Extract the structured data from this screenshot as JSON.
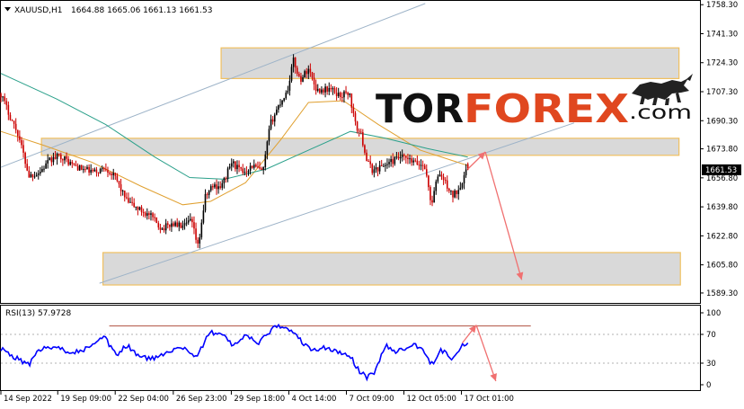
{
  "header": {
    "symbol": "XAUUSD,H1",
    "ohlc": "1664.88 1665.06 1661.13 1661.53"
  },
  "logo": {
    "part1": "TOR",
    "part2": "FOREX",
    "suffix": ".com"
  },
  "colors": {
    "bull_candle": "#000000",
    "bear_candle": "#cc0000",
    "ma_fast": "#e0a030",
    "ma_slow": "#2aa08a",
    "channel": "#9db3c8",
    "zone_fill": "#d9d9d9",
    "zone_border": "#f0c060",
    "forecast_arrow": "#f07070",
    "rsi_line": "#0000ff",
    "rsi_resistance": "#b05040"
  },
  "chart_data": [
    {
      "type": "candlestick",
      "title": "XAUUSD,H1",
      "symbol": "XAUUSD",
      "timeframe": "H1",
      "last_bar": {
        "open": 1664.88,
        "high": 1665.06,
        "low": 1661.13,
        "close": 1661.53
      },
      "current_price_label": "1661.53",
      "ylim": [
        1584.0,
        1760.0
      ],
      "y_ticks": [
        "1758.30",
        "1741.30",
        "1724.30",
        "1707.30",
        "1690.30",
        "1673.80",
        "1656.80",
        "1639.80",
        "1622.80",
        "1605.80",
        "1589.30"
      ],
      "y_tick_values": [
        1758.3,
        1741.3,
        1724.3,
        1707.3,
        1690.3,
        1673.8,
        1656.8,
        1639.8,
        1622.8,
        1605.8,
        1589.3
      ],
      "x_ticks": [
        "14 Sep 2022",
        "19 Sep 09:00",
        "22 Sep 04:00",
        "26 Sep 23:00",
        "29 Sep 18:00",
        "4 Oct 14:00",
        "7 Oct 09:00",
        "12 Oct 05:00",
        "17 Oct 01:00"
      ],
      "x_tick_pos": [
        0,
        0.0813,
        0.1635,
        0.2466,
        0.3296,
        0.4119,
        0.4942,
        0.5765,
        0.6588
      ],
      "price_path": [
        [
          0.0,
          1706
        ],
        [
          0.012,
          1694
        ],
        [
          0.025,
          1682
        ],
        [
          0.04,
          1658
        ],
        [
          0.055,
          1660
        ],
        [
          0.07,
          1667
        ],
        [
          0.085,
          1670
        ],
        [
          0.1,
          1665
        ],
        [
          0.115,
          1662
        ],
        [
          0.135,
          1660
        ],
        [
          0.15,
          1663
        ],
        [
          0.165,
          1656
        ],
        [
          0.18,
          1643
        ],
        [
          0.195,
          1639
        ],
        [
          0.215,
          1634
        ],
        [
          0.23,
          1627
        ],
        [
          0.245,
          1630
        ],
        [
          0.262,
          1628
        ],
        [
          0.272,
          1632
        ],
        [
          0.282,
          1616
        ],
        [
          0.292,
          1645
        ],
        [
          0.302,
          1652
        ],
        [
          0.316,
          1652
        ],
        [
          0.33,
          1666
        ],
        [
          0.345,
          1660
        ],
        [
          0.36,
          1664
        ],
        [
          0.375,
          1660
        ],
        [
          0.385,
          1688
        ],
        [
          0.397,
          1699
        ],
        [
          0.41,
          1708
        ],
        [
          0.418,
          1726
        ],
        [
          0.428,
          1714
        ],
        [
          0.44,
          1721
        ],
        [
          0.452,
          1708
        ],
        [
          0.47,
          1709
        ],
        [
          0.485,
          1705
        ],
        [
          0.498,
          1707
        ],
        [
          0.507,
          1688
        ],
        [
          0.516,
          1681
        ],
        [
          0.524,
          1666
        ],
        [
          0.532,
          1661
        ],
        [
          0.552,
          1665
        ],
        [
          0.572,
          1669
        ],
        [
          0.595,
          1665
        ],
        [
          0.606,
          1664
        ],
        [
          0.616,
          1641
        ],
        [
          0.626,
          1660
        ],
        [
          0.633,
          1656
        ],
        [
          0.646,
          1646
        ],
        [
          0.654,
          1650
        ],
        [
          0.664,
          1659
        ],
        [
          0.668,
          1661.53
        ]
      ],
      "moving_averages": [
        {
          "name": "MA fast",
          "color": "#e0a030",
          "points": [
            [
              0.0,
              1684
            ],
            [
              0.06,
              1676
            ],
            [
              0.13,
              1666
            ],
            [
              0.2,
              1652
            ],
            [
              0.26,
              1641
            ],
            [
              0.3,
              1643
            ],
            [
              0.35,
              1654
            ],
            [
              0.4,
              1679
            ],
            [
              0.44,
              1701
            ],
            [
              0.49,
              1702
            ],
            [
              0.54,
              1688
            ],
            [
              0.6,
              1673
            ],
            [
              0.668,
              1664
            ]
          ]
        },
        {
          "name": "MA slow",
          "color": "#2aa08a",
          "points": [
            [
              0.0,
              1718
            ],
            [
              0.08,
              1703
            ],
            [
              0.15,
              1688
            ],
            [
              0.22,
              1669
            ],
            [
              0.27,
              1657
            ],
            [
              0.32,
              1656
            ],
            [
              0.38,
              1662
            ],
            [
              0.44,
              1673
            ],
            [
              0.5,
              1684
            ],
            [
              0.55,
              1680
            ],
            [
              0.61,
              1674
            ],
            [
              0.668,
              1669
            ]
          ]
        }
      ],
      "channel_lines": [
        {
          "from": [
            0.0,
            1663
          ],
          "to": [
            0.607,
            1759
          ]
        },
        {
          "from": [
            0.141,
            1595
          ],
          "to": [
            0.82,
            1689
          ]
        }
      ],
      "zones": [
        {
          "x_range": [
            0.315,
            0.97
          ],
          "y_range": [
            1715,
            1733
          ]
        },
        {
          "x_range": [
            0.058,
            0.97
          ],
          "y_range": [
            1670,
            1680
          ]
        },
        {
          "x_range": [
            0.146,
            0.972
          ],
          "y_range": [
            1594,
            1613
          ]
        }
      ],
      "forecast_arrows": [
        {
          "from": [
            0.668,
            1662
          ],
          "to": [
            0.693,
            1672
          ]
        },
        {
          "from": [
            0.693,
            1672
          ],
          "to": [
            0.745,
            1597
          ]
        }
      ]
    },
    {
      "type": "line",
      "title": "RSI(13) 57.9728",
      "indicator": "RSI",
      "period": 13,
      "current_value": 57.9728,
      "ylim": [
        0,
        100
      ],
      "y_ticks": [
        "100",
        "70",
        "30",
        "0"
      ],
      "y_tick_values": [
        100,
        70,
        30,
        0
      ],
      "levels": [
        70,
        30
      ],
      "rsi_path": [
        [
          0.0,
          50
        ],
        [
          0.02,
          38
        ],
        [
          0.04,
          28
        ],
        [
          0.055,
          48
        ],
        [
          0.07,
          52
        ],
        [
          0.09,
          48
        ],
        [
          0.11,
          46
        ],
        [
          0.13,
          53
        ],
        [
          0.148,
          66
        ],
        [
          0.165,
          40
        ],
        [
          0.18,
          55
        ],
        [
          0.2,
          38
        ],
        [
          0.22,
          36
        ],
        [
          0.24,
          48
        ],
        [
          0.262,
          52
        ],
        [
          0.28,
          38
        ],
        [
          0.298,
          72
        ],
        [
          0.315,
          73
        ],
        [
          0.33,
          55
        ],
        [
          0.35,
          67
        ],
        [
          0.37,
          58
        ],
        [
          0.39,
          80
        ],
        [
          0.41,
          80
        ],
        [
          0.43,
          60
        ],
        [
          0.445,
          47
        ],
        [
          0.465,
          52
        ],
        [
          0.48,
          45
        ],
        [
          0.498,
          42
        ],
        [
          0.512,
          20
        ],
        [
          0.524,
          10
        ],
        [
          0.535,
          18
        ],
        [
          0.55,
          55
        ],
        [
          0.565,
          45
        ],
        [
          0.585,
          55
        ],
        [
          0.6,
          53
        ],
        [
          0.616,
          28
        ],
        [
          0.63,
          48
        ],
        [
          0.645,
          38
        ],
        [
          0.66,
          55
        ],
        [
          0.668,
          57.97
        ]
      ],
      "resistance_line": {
        "from": [
          0.155,
          81.7
        ],
        "to": [
          0.758,
          81.7
        ]
      },
      "forecast_arrows": [
        {
          "from": [
            0.66,
            58
          ],
          "to": [
            0.68,
            83
          ]
        },
        {
          "from": [
            0.68,
            83
          ],
          "to": [
            0.708,
            5
          ]
        }
      ]
    }
  ]
}
